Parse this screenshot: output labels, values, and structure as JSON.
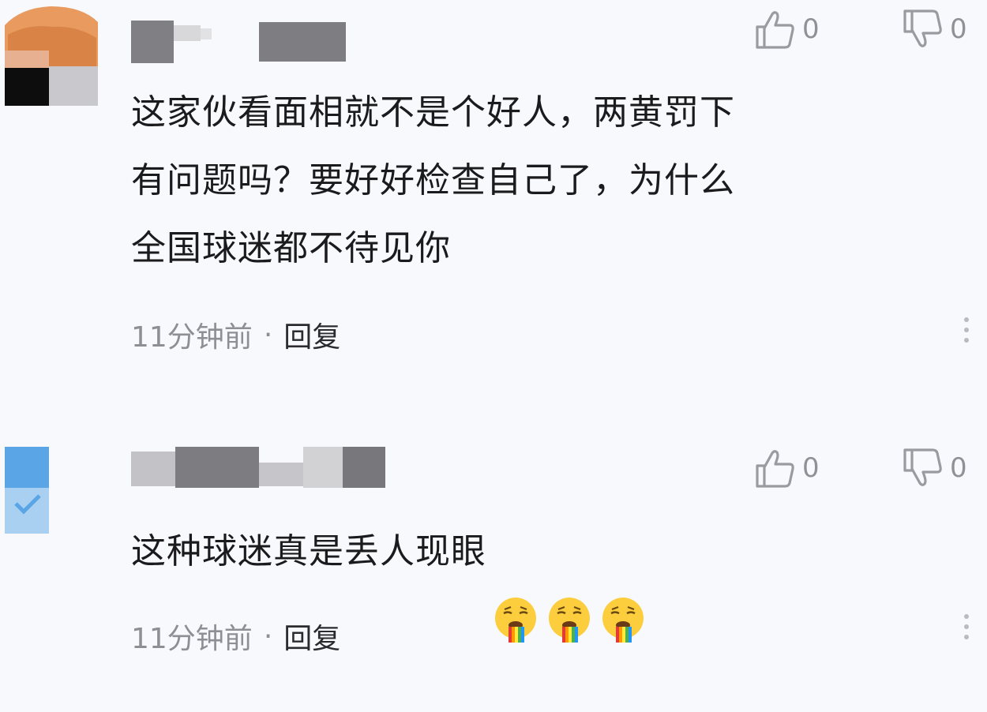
{
  "comments": [
    {
      "text": "这家伙看面相就不是个好人，两黄罚下\n有问题吗？要好好检查自己了，为什么\n全国球迷都不待见你",
      "time": "11分钟前",
      "separator": "·",
      "reply_label": "回复",
      "likes": "0",
      "dislikes": "0"
    },
    {
      "text": "这种球迷真是丢人现眼",
      "emojis": [
        "vomiting-face-emoji",
        "vomiting-face-emoji",
        "vomiting-face-emoji"
      ],
      "time": "11分钟前",
      "separator": "·",
      "reply_label": "回复",
      "likes": "0",
      "dislikes": "0"
    }
  ],
  "icons": {
    "like": "thumbs-up-icon",
    "dislike": "thumbs-down-icon",
    "more": "more-vertical-icon"
  },
  "colors": {
    "background": "#f8f9fd",
    "text": "#1b1b1d",
    "muted": "#8e8f94",
    "icon": "#9a9ba0"
  }
}
